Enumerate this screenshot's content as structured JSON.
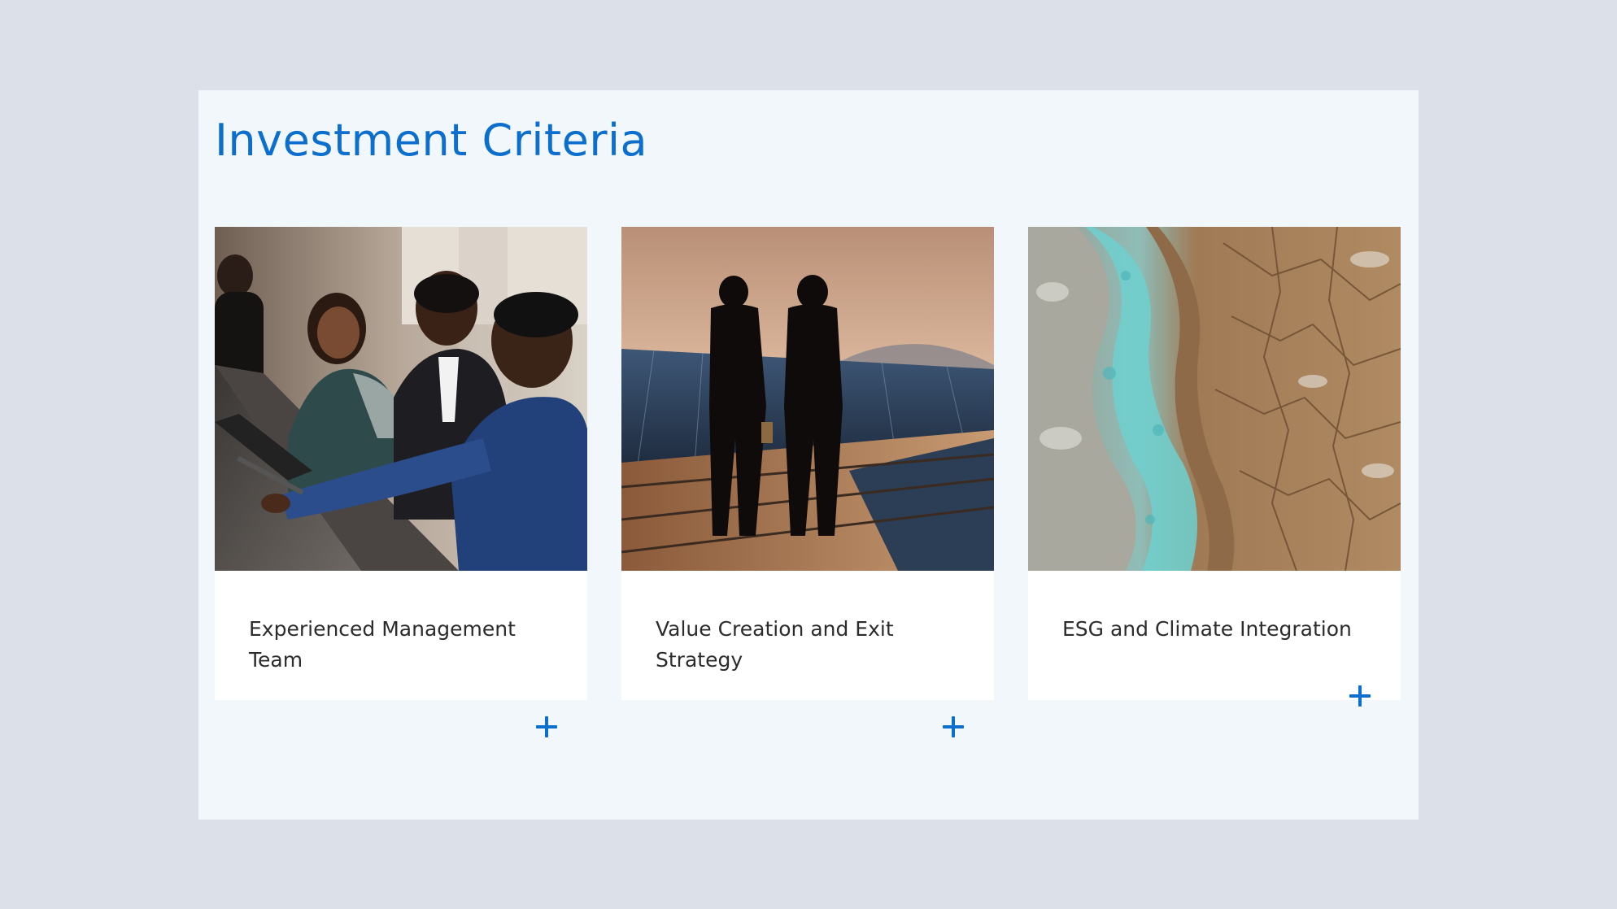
{
  "section": {
    "title": "Investment Criteria"
  },
  "cards": [
    {
      "label": "Experienced Management Team",
      "image": "business-team-meeting-photo",
      "icon": "plus-icon"
    },
    {
      "label": "Value Creation and Exit Strategy",
      "image": "solar-panel-engineers-silhouette-photo",
      "icon": "plus-icon"
    },
    {
      "label": "ESG and Climate Integration",
      "image": "cracked-earth-aerial-photo",
      "icon": "plus-icon"
    }
  ],
  "colors": {
    "page_background": "#dce0e8",
    "panel_background": "#f2f7fc",
    "accent": "#0c6fce",
    "card_background": "#ffffff",
    "text": "#2c2c2c"
  }
}
